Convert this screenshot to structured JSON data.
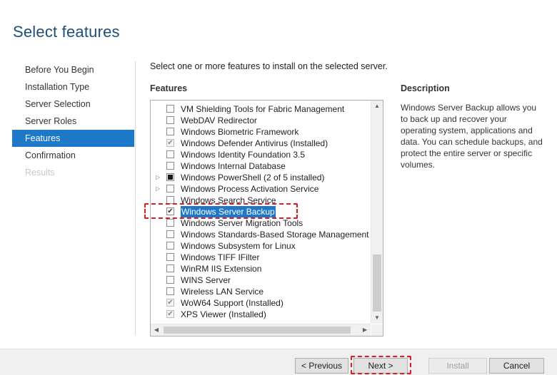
{
  "page": {
    "title": "Select features"
  },
  "nav": {
    "items": [
      {
        "label": "Before You Begin",
        "state": "normal"
      },
      {
        "label": "Installation Type",
        "state": "normal"
      },
      {
        "label": "Server Selection",
        "state": "normal"
      },
      {
        "label": "Server Roles",
        "state": "normal"
      },
      {
        "label": "Features",
        "state": "active"
      },
      {
        "label": "Confirmation",
        "state": "normal"
      },
      {
        "label": "Results",
        "state": "disabled"
      }
    ]
  },
  "main": {
    "instruction": "Select one or more features to install on the selected server.",
    "features_label": "Features",
    "features": [
      {
        "label": "VM Shielding Tools for Fabric Management",
        "check": "none",
        "expander": false
      },
      {
        "label": "WebDAV Redirector",
        "check": "none",
        "expander": false
      },
      {
        "label": "Windows Biometric Framework",
        "check": "none",
        "expander": false
      },
      {
        "label": "Windows Defender Antivirus (Installed)",
        "check": "installed",
        "expander": false
      },
      {
        "label": "Windows Identity Foundation 3.5",
        "check": "none",
        "expander": false
      },
      {
        "label": "Windows Internal Database",
        "check": "none",
        "expander": false
      },
      {
        "label": "Windows PowerShell (2 of 5 installed)",
        "check": "partial",
        "expander": true
      },
      {
        "label": "Windows Process Activation Service",
        "check": "none",
        "expander": true
      },
      {
        "label": "Windows Search Service",
        "check": "none",
        "expander": false
      },
      {
        "label": "Windows Server Backup",
        "check": "checked",
        "expander": false,
        "selected": true
      },
      {
        "label": "Windows Server Migration Tools",
        "check": "none",
        "expander": false
      },
      {
        "label": "Windows Standards-Based Storage Management",
        "check": "none",
        "expander": false
      },
      {
        "label": "Windows Subsystem for Linux",
        "check": "none",
        "expander": false
      },
      {
        "label": "Windows TIFF IFilter",
        "check": "none",
        "expander": false
      },
      {
        "label": "WinRM IIS Extension",
        "check": "none",
        "expander": false
      },
      {
        "label": "WINS Server",
        "check": "none",
        "expander": false
      },
      {
        "label": "Wireless LAN Service",
        "check": "none",
        "expander": false
      },
      {
        "label": "WoW64 Support (Installed)",
        "check": "installed",
        "expander": false
      },
      {
        "label": "XPS Viewer (Installed)",
        "check": "installed",
        "expander": false
      }
    ]
  },
  "description": {
    "title": "Description",
    "text": "Windows Server Backup allows you to back up and recover your operating system, applications and data. You can schedule backups, and protect the entire server or specific volumes."
  },
  "footer": {
    "previous_label": "< Previous",
    "next_label": "Next >",
    "install_label": "Install",
    "cancel_label": "Cancel"
  },
  "colors": {
    "accent": "#1e78c8",
    "title": "#1e4e79",
    "highlight_annotation": "#e01b24"
  },
  "icons": {
    "expander": "chevron-right-icon",
    "scroll_up": "scroll-up-arrow-icon",
    "scroll_down": "scroll-down-arrow-icon",
    "scroll_left": "scroll-left-arrow-icon",
    "scroll_right": "scroll-right-arrow-icon"
  }
}
